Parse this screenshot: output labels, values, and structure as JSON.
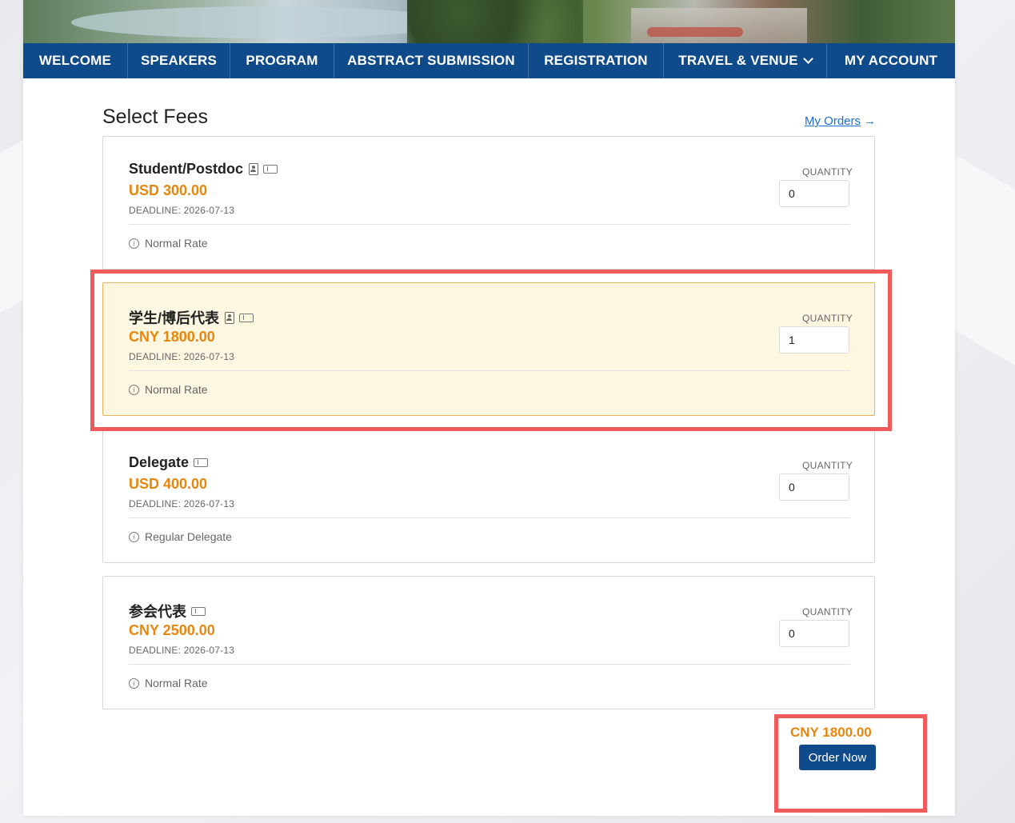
{
  "nav": {
    "items": [
      {
        "label": "WELCOME"
      },
      {
        "label": "SPEAKERS"
      },
      {
        "label": "PROGRAM"
      },
      {
        "label": "ABSTRACT SUBMISSION"
      },
      {
        "label": "REGISTRATION"
      },
      {
        "label": "TRAVEL & VENUE",
        "has_dropdown": true
      },
      {
        "label": "MY ACCOUNT"
      }
    ]
  },
  "section": {
    "title": "Select Fees",
    "my_orders_label": "My Orders",
    "my_orders_arrow": "→"
  },
  "fees": [
    {
      "name": "Student/Postdoc",
      "icons": [
        "id-card-icon",
        "ticket-icon"
      ],
      "price": "USD 300.00",
      "deadline": "DEADLINE: 2026-07-13",
      "note": "Normal Rate",
      "quantity_label": "QUANTITY",
      "quantity": "0",
      "selected": false
    },
    {
      "name": "学生/博后代表",
      "icons": [
        "id-card-icon",
        "ticket-icon"
      ],
      "price": "CNY 1800.00",
      "deadline": "DEADLINE: 2026-07-13",
      "note": "Normal Rate",
      "quantity_label": "QUANTITY",
      "quantity": "1",
      "selected": true
    },
    {
      "name": "Delegate",
      "icons": [
        "ticket-icon"
      ],
      "price": "USD 400.00",
      "deadline": "DEADLINE: 2026-07-13",
      "note": "Regular Delegate",
      "quantity_label": "QUANTITY",
      "quantity": "0",
      "selected": false
    },
    {
      "name": "参会代表",
      "icons": [
        "ticket-icon"
      ],
      "price": "CNY 2500.00",
      "deadline": "DEADLINE: 2026-07-13",
      "note": "Normal Rate",
      "quantity_label": "QUANTITY",
      "quantity": "0",
      "selected": false
    }
  ],
  "summary": {
    "total": "CNY 1800.00",
    "order_button_label": "Order Now"
  },
  "colors": {
    "nav_bg": "#0f4a8a",
    "price": "#e8860c",
    "link": "#1d6fd0",
    "selected_bg": "#fdf6e1",
    "highlight": "#ef5a5a"
  }
}
